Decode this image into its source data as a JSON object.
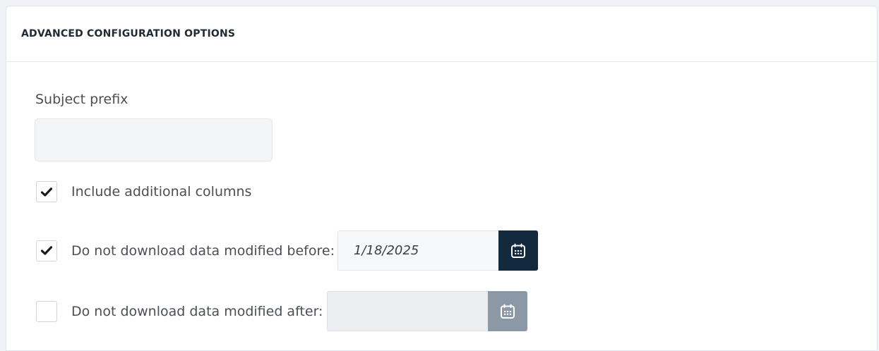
{
  "panel": {
    "title": "ADVANCED CONFIGURATION OPTIONS"
  },
  "subject_prefix": {
    "label": "Subject prefix",
    "value": "",
    "placeholder": ""
  },
  "options": {
    "include_columns": {
      "label": "Include additional columns",
      "checked": true
    },
    "modified_before": {
      "label": "Do not download data modified before:",
      "checked": true,
      "date_value": "1/18/2025",
      "calendar_icon": "calendar-icon"
    },
    "modified_after": {
      "label": "Do not download data modified after:",
      "checked": false,
      "date_value": "",
      "calendar_icon": "calendar-icon"
    }
  },
  "colors": {
    "calendar_button_active": "#13293d",
    "calendar_button_disabled": "#8b98a6"
  }
}
